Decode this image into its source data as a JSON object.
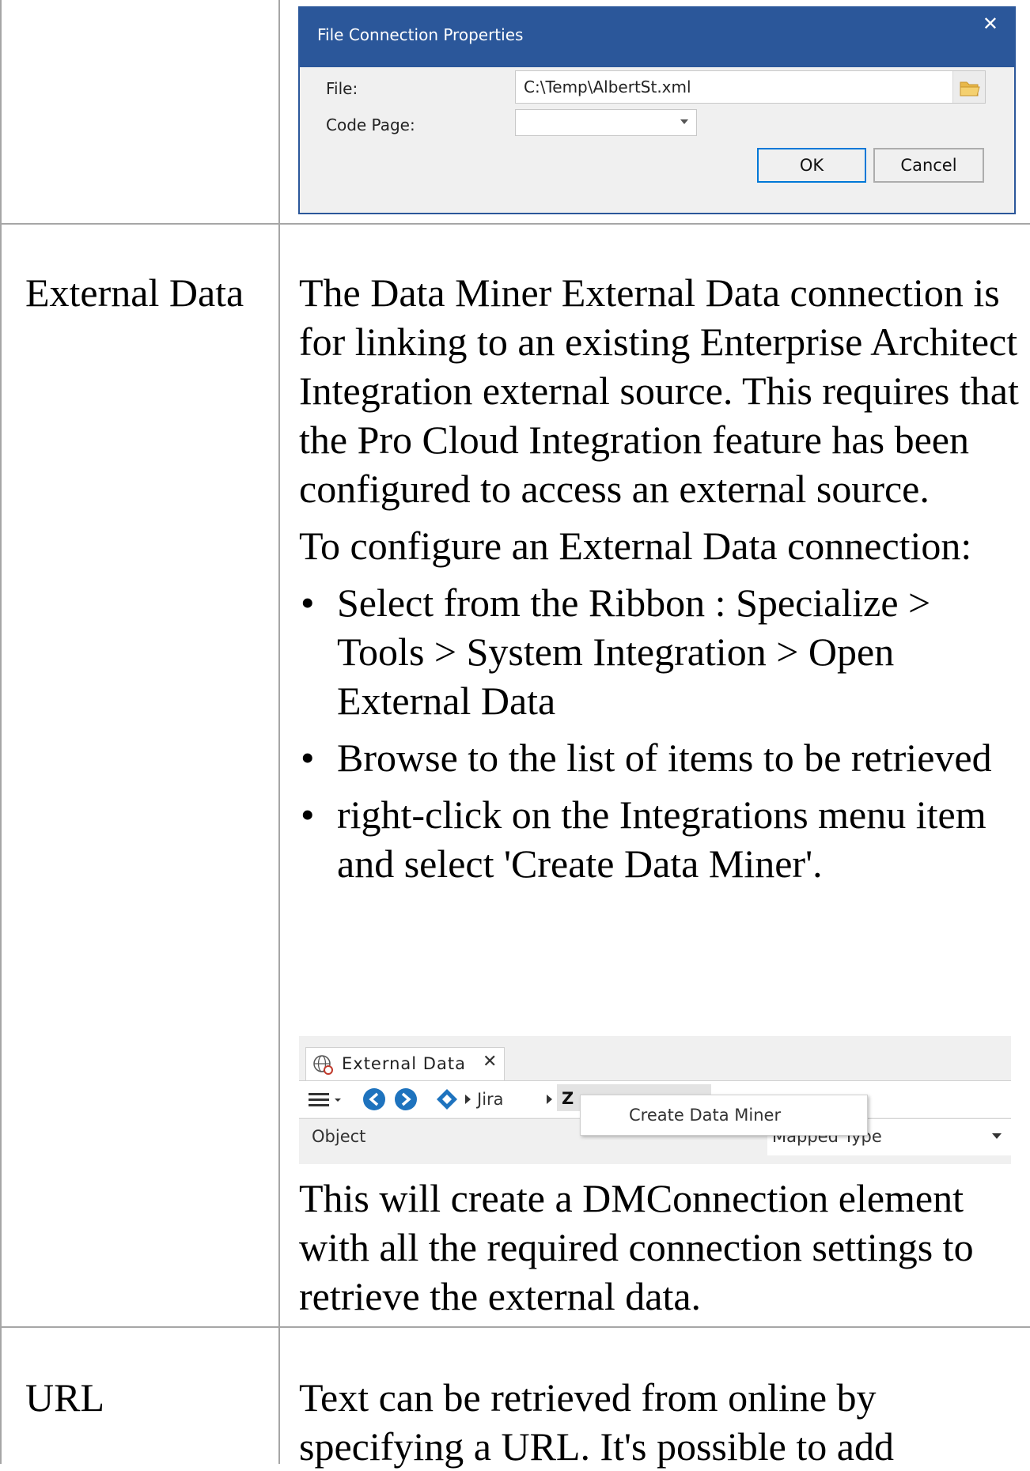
{
  "dialog": {
    "title": "File Connection Properties",
    "close_glyph": "✕",
    "file_label": "File:",
    "file_value": "C:\\Temp\\AlbertSt.xml",
    "code_page_label": "Code Page:",
    "code_page_value": "",
    "ok_label": "OK",
    "cancel_label": "Cancel"
  },
  "rows": [
    {
      "label": "External Data",
      "paragraphs": [
        "The Data Miner External Data connection is for linking to an existing Enterprise Architect Integration external source. This requires that the Pro Cloud Integration feature has been configured to access an external source.",
        "To configure an External Data connection:"
      ],
      "bullets": [
        "Select from the Ribbon : Specialize > Tools > System Integration > Open External Data",
        "Browse to the list of items to be retrieved",
        "right-click on the Integrations menu item and select 'Create Data Miner'."
      ],
      "after": "This will create a DMConnection element with all the required connection settings to retrieve the external data."
    },
    {
      "label": "URL",
      "text": "Text can be retrieved from online by specifying a URL. It's possible to add"
    }
  ],
  "external_window": {
    "tab_label": "External Data",
    "tab_close": "✕",
    "breadcrumb_jira": "Jira",
    "breadcrumb_partial": "Z",
    "context_menu_item": "Create Data Miner",
    "col_object": "Object",
    "col_mapped_type": "Mapped Type"
  },
  "colors": {
    "dialog_title_bg": "#2b579a",
    "nav_icon_blue": "#1e73be",
    "border_gray": "#a6a6a6"
  }
}
